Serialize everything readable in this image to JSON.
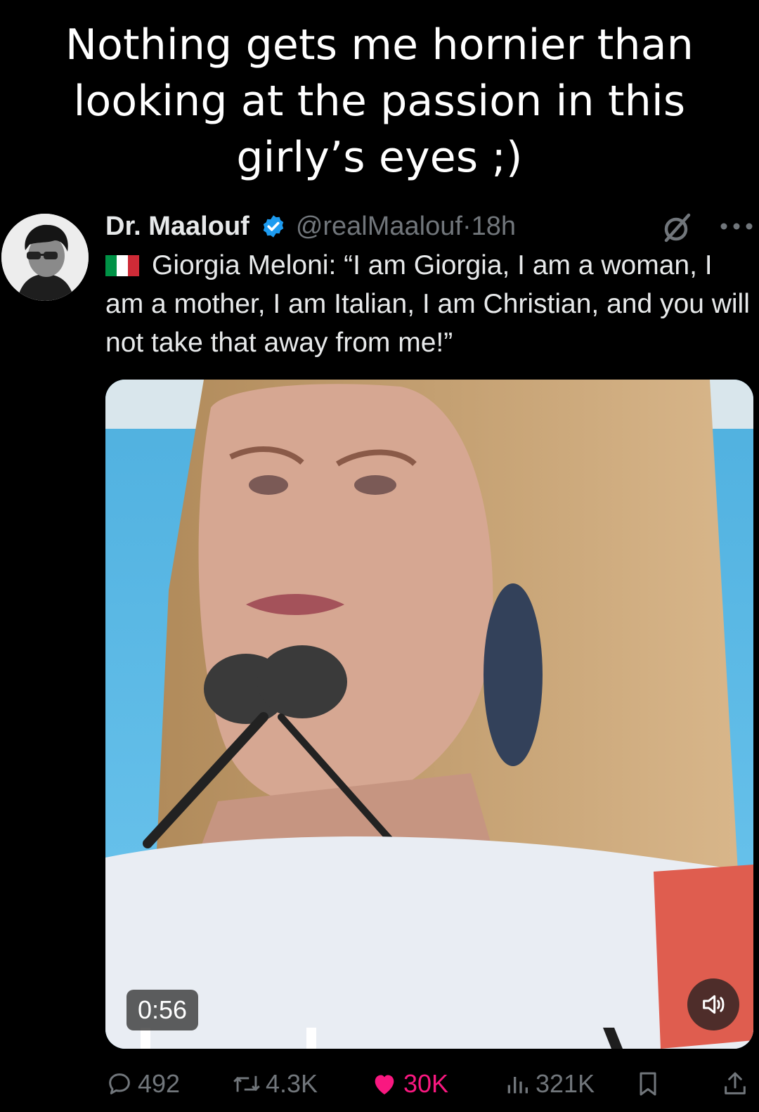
{
  "caption": {
    "lines": [
      "Nothing gets me hornier than",
      "looking at the passion in this",
      "girly’s eyes ;)"
    ]
  },
  "tweet": {
    "display_name": "Dr. Maalouf",
    "handle": "@realMaalouf",
    "separator": "·",
    "time": "18h",
    "text": "Giorgia Meloni: “I am Giorgia, I am a woman, I am a mother, I am Italian, I am Christian, and you will not take that away from me!”",
    "flag_icon": "italy-flag-icon"
  },
  "media": {
    "duration": "0:56"
  },
  "actions": {
    "replies": "492",
    "reposts": "4.3K",
    "likes": "30K",
    "views": "321K"
  },
  "colors": {
    "background": "#000000",
    "text": "#e7e9ea",
    "muted": "#71767b",
    "like": "#f91880",
    "verified": "#1d9bf0"
  }
}
